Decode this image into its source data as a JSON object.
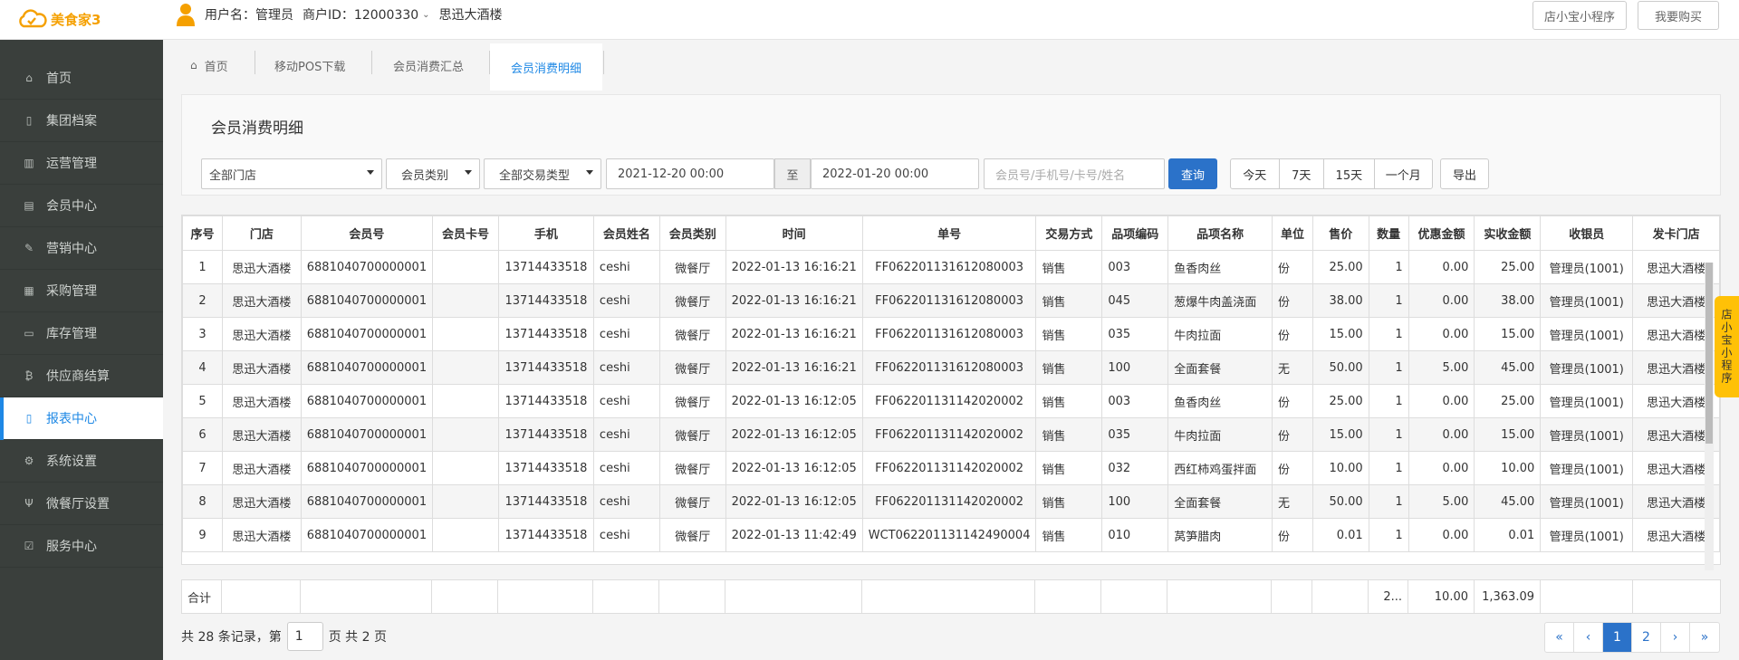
{
  "header": {
    "logo_text": "美食家3",
    "user_label": "用户名：管理员",
    "merchant_label": "商户ID：12000330",
    "store_name": "思迅大酒楼",
    "btn_mini_program": "店小宝小程序",
    "btn_buy": "我要购买"
  },
  "sidebar": {
    "items": [
      {
        "label": "首页",
        "icon": "home-icon"
      },
      {
        "label": "集团档案",
        "icon": "file-icon"
      },
      {
        "label": "运营管理",
        "icon": "bar-chart-icon"
      },
      {
        "label": "会员中心",
        "icon": "id-card-icon"
      },
      {
        "label": "营销中心",
        "icon": "edit-icon"
      },
      {
        "label": "采购管理",
        "icon": "book-icon"
      },
      {
        "label": "库存管理",
        "icon": "document-icon"
      },
      {
        "label": "供应商结算",
        "icon": "bitcoin-icon"
      },
      {
        "label": "报表中心",
        "icon": "report-icon"
      },
      {
        "label": "系统设置",
        "icon": "gears-icon"
      },
      {
        "label": "微餐厅设置",
        "icon": "utensils-icon"
      },
      {
        "label": "服务中心",
        "icon": "check-square-icon"
      }
    ],
    "active": "报表中心"
  },
  "tabs": {
    "home": "首页",
    "pos": "移动POS下载",
    "summary": "会员消费汇总",
    "detail": "会员消费明细"
  },
  "panel": {
    "title": "会员消费明细",
    "store_select": "全部门店",
    "member_type_select": "会员类别",
    "trade_type_select": "全部交易类型",
    "date_from": "2021-12-20 00:00",
    "date_to_label": "至",
    "date_to": "2022-01-20 00:00",
    "search_placeholder": "会员号/手机号/卡号/姓名",
    "query_btn": "查询",
    "quick_ranges": [
      "今天",
      "7天",
      "15天",
      "一个月"
    ],
    "export_btn": "导出"
  },
  "table": {
    "columns": [
      "序号",
      "门店",
      "会员号",
      "会员卡号",
      "手机",
      "会员姓名",
      "会员类别",
      "时间",
      "单号",
      "交易方式",
      "品项编码",
      "品项名称",
      "单位",
      "售价",
      "数量",
      "优惠金额",
      "实收金额",
      "收银员",
      "发卡门店"
    ],
    "rows": [
      [
        "1",
        "思迅大酒楼",
        "6881040700000001",
        "",
        "13714433518",
        "ceshi",
        "微餐厅",
        "2022-01-13 16:16:21",
        "FF062201131612080003",
        "销售",
        "003",
        "鱼香肉丝",
        "份",
        "25.00",
        "1",
        "0.00",
        "25.00",
        "管理员(1001)",
        "思迅大酒楼"
      ],
      [
        "2",
        "思迅大酒楼",
        "6881040700000001",
        "",
        "13714433518",
        "ceshi",
        "微餐厅",
        "2022-01-13 16:16:21",
        "FF062201131612080003",
        "销售",
        "045",
        "葱爆牛肉盖浇面",
        "份",
        "38.00",
        "1",
        "0.00",
        "38.00",
        "管理员(1001)",
        "思迅大酒楼"
      ],
      [
        "3",
        "思迅大酒楼",
        "6881040700000001",
        "",
        "13714433518",
        "ceshi",
        "微餐厅",
        "2022-01-13 16:16:21",
        "FF062201131612080003",
        "销售",
        "035",
        "牛肉拉面",
        "份",
        "15.00",
        "1",
        "0.00",
        "15.00",
        "管理员(1001)",
        "思迅大酒楼"
      ],
      [
        "4",
        "思迅大酒楼",
        "6881040700000001",
        "",
        "13714433518",
        "ceshi",
        "微餐厅",
        "2022-01-13 16:16:21",
        "FF062201131612080003",
        "销售",
        "100",
        "全面套餐",
        "无",
        "50.00",
        "1",
        "5.00",
        "45.00",
        "管理员(1001)",
        "思迅大酒楼"
      ],
      [
        "5",
        "思迅大酒楼",
        "6881040700000001",
        "",
        "13714433518",
        "ceshi",
        "微餐厅",
        "2022-01-13 16:12:05",
        "FF062201131142020002",
        "销售",
        "003",
        "鱼香肉丝",
        "份",
        "25.00",
        "1",
        "0.00",
        "25.00",
        "管理员(1001)",
        "思迅大酒楼"
      ],
      [
        "6",
        "思迅大酒楼",
        "6881040700000001",
        "",
        "13714433518",
        "ceshi",
        "微餐厅",
        "2022-01-13 16:12:05",
        "FF062201131142020002",
        "销售",
        "035",
        "牛肉拉面",
        "份",
        "15.00",
        "1",
        "0.00",
        "15.00",
        "管理员(1001)",
        "思迅大酒楼"
      ],
      [
        "7",
        "思迅大酒楼",
        "6881040700000001",
        "",
        "13714433518",
        "ceshi",
        "微餐厅",
        "2022-01-13 16:12:05",
        "FF062201131142020002",
        "销售",
        "032",
        "西红柿鸡蛋拌面",
        "份",
        "10.00",
        "1",
        "0.00",
        "10.00",
        "管理员(1001)",
        "思迅大酒楼"
      ],
      [
        "8",
        "思迅大酒楼",
        "6881040700000001",
        "",
        "13714433518",
        "ceshi",
        "微餐厅",
        "2022-01-13 16:12:05",
        "FF062201131142020002",
        "销售",
        "100",
        "全面套餐",
        "无",
        "50.00",
        "1",
        "5.00",
        "45.00",
        "管理员(1001)",
        "思迅大酒楼"
      ],
      [
        "9",
        "思迅大酒楼",
        "6881040700000001",
        "",
        "13714433518",
        "ceshi",
        "微餐厅",
        "2022-01-13 11:42:49",
        "WCT062201131142490004",
        "销售",
        "010",
        "莴笋腊肉",
        "份",
        "0.01",
        "1",
        "0.00",
        "0.01",
        "管理员(1001)",
        "思迅大酒楼"
      ]
    ]
  },
  "totals": {
    "label": "合计",
    "qty": "2...",
    "discount": "10.00",
    "received": "1,363.09"
  },
  "pagination": {
    "prefix": "共 28 条记录，第",
    "page_value": "1",
    "suffix": "页 共 2 页",
    "first": "«",
    "prev": "‹",
    "pages": [
      "1",
      "2"
    ],
    "next": "›",
    "last": "»"
  },
  "float_tab": "店小宝小程序"
}
